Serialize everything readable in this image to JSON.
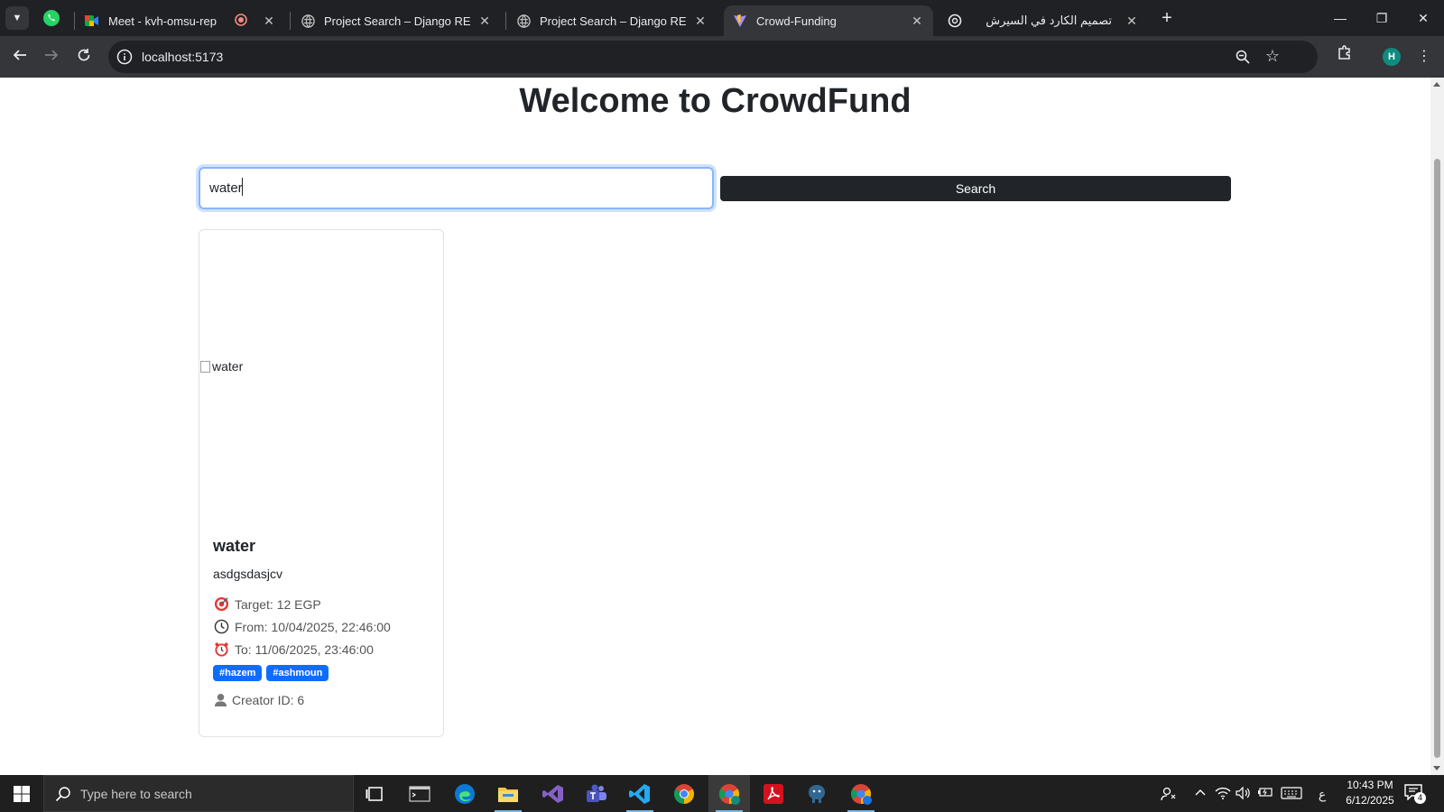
{
  "browser": {
    "tabs": [
      {
        "title": "Meet - kvh-omsu-rep",
        "favicon": "google-meet-icon"
      },
      {
        "title": "Project Search – Django REST fr",
        "favicon": "globe-icon"
      },
      {
        "title": "Project Search – Django REST fr",
        "favicon": "globe-icon"
      },
      {
        "title": "Crowd-Funding",
        "favicon": "vite-icon"
      },
      {
        "title": "تصميم الكارد في السيرش",
        "favicon": "chatgpt-icon"
      }
    ],
    "active_tab_index": 3,
    "url": "localhost:5173",
    "profile_initial": "H"
  },
  "page": {
    "title": "Welcome to CrowdFund",
    "search": {
      "value": "water",
      "button_label": "Search"
    },
    "projects": [
      {
        "image_alt": "water",
        "title": "water",
        "description": "asdgsdasjcv",
        "target": "Target: 12 EGP",
        "from": "From: 10/04/2025, 22:46:00",
        "to": "To: 11/06/2025, 23:46:00",
        "tags": [
          "#hazem",
          "#ashmoun"
        ],
        "creator": "Creator ID: 6"
      }
    ]
  },
  "taskbar": {
    "search_placeholder": "Type here to search",
    "language": "ع",
    "time": "10:43 PM",
    "date": "6/12/2025",
    "notification_count": "4"
  },
  "colors": {
    "dark_button": "#212529",
    "tag_blue": "#0d6efd",
    "focus_border": "#86b7fe"
  }
}
